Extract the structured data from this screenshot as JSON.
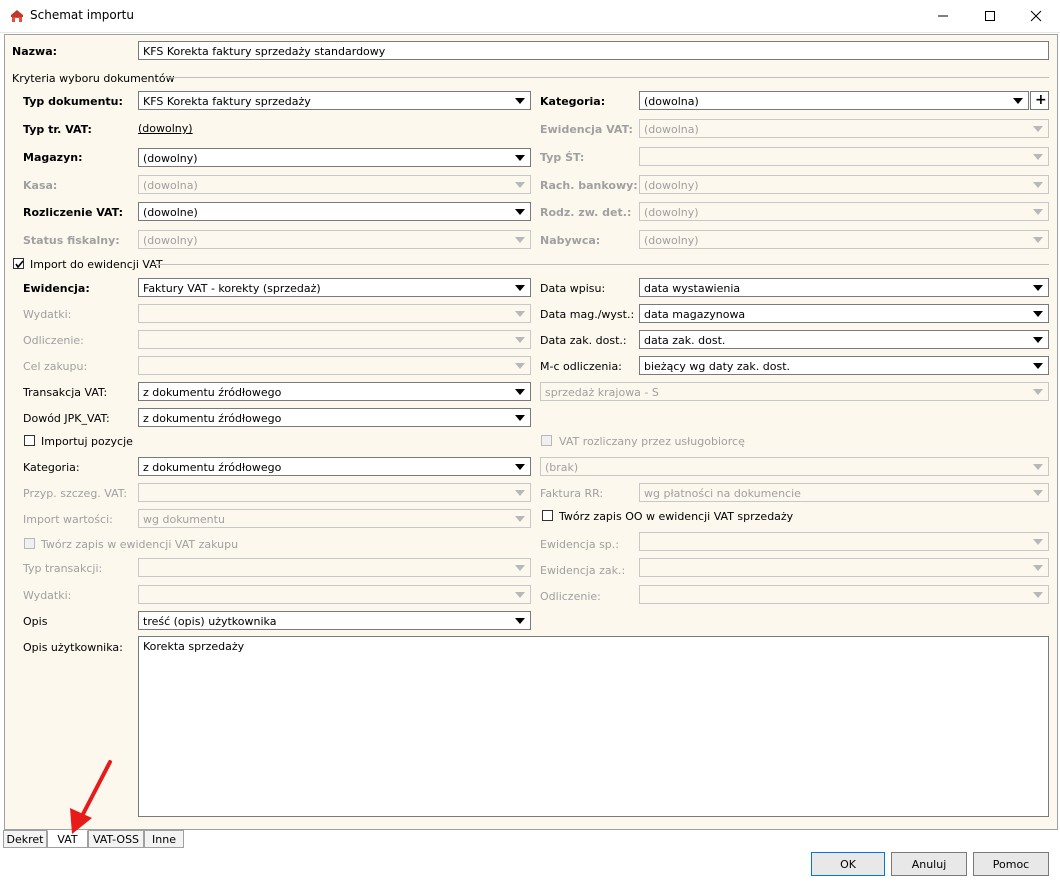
{
  "window": {
    "title": "Schemat importu"
  },
  "nazwa": {
    "label": "Nazwa:",
    "value": "KFS Korekta faktury sprzedaży standardowy"
  },
  "kryteria": {
    "group_label": "Kryteria wyboru dokumentów",
    "typ_dokumentu": {
      "label": "Typ dokumentu:",
      "value": "KFS Korekta faktury sprzedaży"
    },
    "kategoria": {
      "label": "Kategoria:",
      "value": "(dowolna)",
      "plus": "+"
    },
    "typ_tr_vat": {
      "label": "Typ tr. VAT:",
      "value": "(dowolny)"
    },
    "ewidencja_vat": {
      "label": "Ewidencja VAT:",
      "value": "(dowolna)"
    },
    "magazyn": {
      "label": "Magazyn:",
      "value": "(dowolny)"
    },
    "typ_st": {
      "label": "Typ ŚT:",
      "value": ""
    },
    "kasa": {
      "label": "Kasa:",
      "value": "(dowolna)"
    },
    "rach_bankowy": {
      "label": "Rach. bankowy:",
      "value": "(dowolny)"
    },
    "rozliczenie_vat": {
      "label": "Rozliczenie VAT:",
      "value": "(dowolne)"
    },
    "rodz_zw_det": {
      "label": "Rodz. zw. det.:",
      "value": "(dowolny)"
    },
    "status_fiskalny": {
      "label": "Status fiskalny:",
      "value": "(dowolny)"
    },
    "nabywca": {
      "label": "Nabywca:",
      "value": "(dowolny)"
    }
  },
  "import_vat": {
    "checkbox_label": "Import do ewidencji VAT",
    "ewidencja": {
      "label": "Ewidencja:",
      "value": "Faktury VAT - korekty (sprzedaż)"
    },
    "data_wpisu": {
      "label": "Data wpisu:",
      "value": "data wystawienia"
    },
    "wydatki": {
      "label": "Wydatki:",
      "value": ""
    },
    "data_mag_wyst": {
      "label": "Data mag./wyst.:",
      "value": "data magazynowa"
    },
    "odliczenie": {
      "label": "Odliczenie:",
      "value": ""
    },
    "data_zak_dost": {
      "label": "Data zak. dost.:",
      "value": "data zak. dost."
    },
    "cel_zakupu": {
      "label": "Cel zakupu:",
      "value": ""
    },
    "mc_odliczenia": {
      "label": "M-c odliczenia:",
      "value": "bieżący wg daty zak. dost."
    },
    "transakcja_vat": {
      "label": "Transakcja VAT:",
      "value": "z dokumentu źródłowego"
    },
    "sprzedaz_krajowa": {
      "value": "sprzedaż krajowa - S"
    },
    "dowod_jpk": {
      "label": "Dowód JPK_VAT:",
      "value": "z dokumentu źródłowego"
    },
    "importuj_pozycje": {
      "label": "Importuj pozycje"
    },
    "vat_rozliczany": {
      "label": "VAT rozliczany przez usługobiorcę"
    },
    "kategoria": {
      "label": "Kategoria:",
      "value": "z dokumentu źródłowego"
    },
    "brak": {
      "value": "(brak)"
    },
    "przyp_szczeg_vat": {
      "label": "Przyp. szczeg. VAT:",
      "value": ""
    },
    "faktura_rr": {
      "label": "Faktura RR:",
      "value": "wg płatności na dokumencie"
    },
    "import_wartosci": {
      "label": "Import wartości:",
      "value": "wg dokumentu"
    },
    "tworz_zapis_oo": {
      "label": "Twórz zapis OO w ewidencji VAT sprzedaży"
    },
    "tworz_zapis_zakupu": {
      "label": "Twórz zapis w ewidencji VAT zakupu"
    },
    "ewidencja_sp": {
      "label": "Ewidencja sp.:",
      "value": ""
    },
    "typ_transakcji": {
      "label": "Typ transakcji:",
      "value": ""
    },
    "ewidencja_zak": {
      "label": "Ewidencja zak.:",
      "value": ""
    },
    "wydatki2": {
      "label": "Wydatki:",
      "value": ""
    },
    "odliczenie2": {
      "label": "Odliczenie:",
      "value": ""
    },
    "opis": {
      "label": "Opis",
      "value": "treść (opis) użytkownika"
    },
    "opis_uzytkownika": {
      "label": "Opis użytkownika:",
      "value": "Korekta sprzedaży"
    }
  },
  "tabs": [
    {
      "label": "Dekret"
    },
    {
      "label": "VAT"
    },
    {
      "label": "VAT-OSS"
    },
    {
      "label": "Inne"
    }
  ],
  "buttons": {
    "ok": "OK",
    "anuluj": "Anuluj",
    "pomoc": "Pomoc"
  },
  "colors": {
    "background": "#fdf8ee",
    "annotation_arrow": "#e81b1b"
  }
}
